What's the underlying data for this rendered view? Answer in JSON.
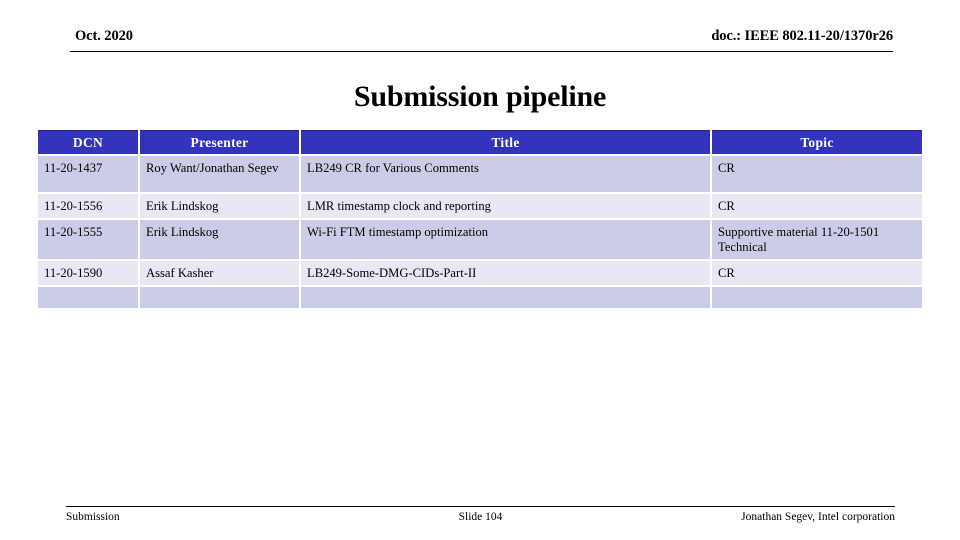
{
  "header": {
    "date": "Oct. 2020",
    "doc_id": "doc.: IEEE 802.11-20/1370r26"
  },
  "title": "Submission pipeline",
  "table": {
    "columns": [
      "DCN",
      "Presenter",
      "Title",
      "Topic"
    ],
    "header_bg": "#3333bb",
    "row_bg_alt_a": "#cbcde8",
    "row_bg_alt_b": "#e7e8f4",
    "rows": [
      {
        "dcn": "11-20-1437",
        "presenter": "Roy Want/Jonathan Segev",
        "title": "LB249 CR for Various Comments",
        "topic": "CR"
      },
      {
        "dcn": "11-20-1556",
        "presenter": "Erik Lindskog",
        "title": "LMR timestamp clock and reporting",
        "topic": "CR"
      },
      {
        "dcn": "11-20-1555",
        "presenter": "Erik Lindskog",
        "title": "Wi-Fi FTM timestamp optimization",
        "topic": "Supportive material 11-20-1501 Technical"
      },
      {
        "dcn": "11-20-1590",
        "presenter": "Assaf Kasher",
        "title": "LB249-Some-DMG-CIDs-Part-II",
        "topic": "CR"
      },
      {
        "dcn": "",
        "presenter": "",
        "title": "",
        "topic": ""
      }
    ]
  },
  "footer": {
    "left": "Submission",
    "center": "Slide 104",
    "right": "Jonathan Segev, Intel corporation"
  }
}
